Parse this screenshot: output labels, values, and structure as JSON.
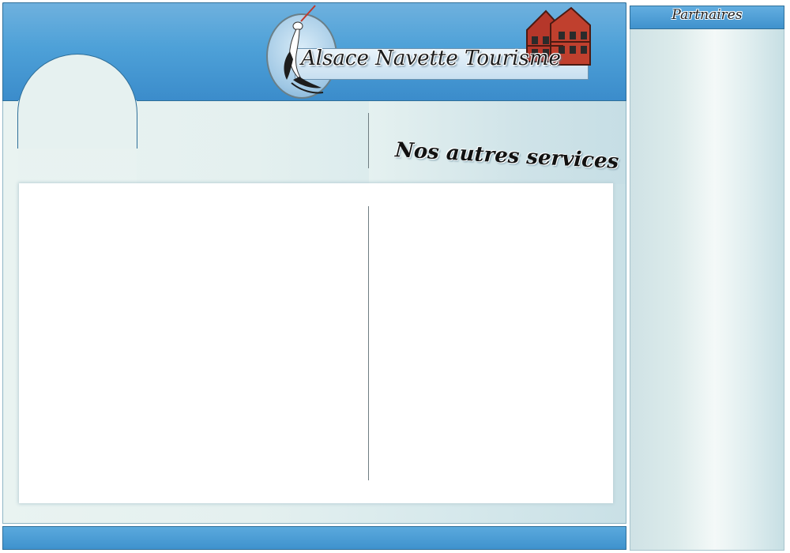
{
  "header": {
    "site_title": "Alsace Navette Tourisme",
    "logo_icons": [
      "stork-icon",
      "half-timbered-house-icon"
    ]
  },
  "main": {
    "section_title": "Nos autres services"
  },
  "sidebar": {
    "title": "Partnaires"
  },
  "colors": {
    "header_blue": "#4ea1d8",
    "panel_bg": "#e6f1f0",
    "house_red": "#b5372a"
  }
}
